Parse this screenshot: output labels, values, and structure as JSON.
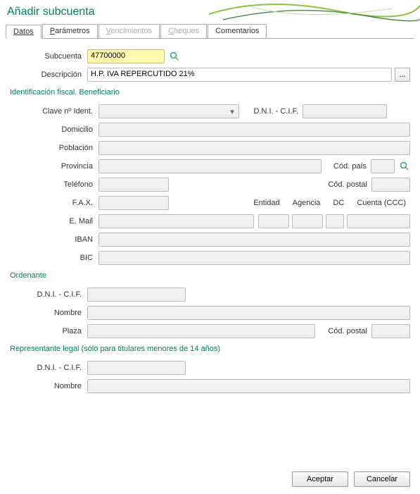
{
  "header": {
    "title": "Añadir subcuenta"
  },
  "tabs": {
    "datos": "Datos",
    "parametros_pre": "P",
    "parametros_rest": "arámetros",
    "vencimientos_pre": "V",
    "vencimientos_rest": "encimientos",
    "cheques_pre": "C",
    "cheques_rest": "heques",
    "comentarios": "Comentarios"
  },
  "form": {
    "subcuenta_label": "Subcuenta",
    "subcuenta_value": "47700000",
    "descripcion_label": "Descripción",
    "descripcion_value": "H.P. IVA REPERCUTIDO 21%",
    "ellipsis": "..."
  },
  "section1": {
    "title": "Identificación fiscal. Beneficiario",
    "clave_label": "Clave nº Ident.",
    "clave_value": "",
    "dni_label": "D.N.I. - C.I.F.",
    "dni_value": "",
    "domicilio_label": "Domicilio",
    "domicilio_value": "",
    "poblacion_label": "Población",
    "poblacion_value": "",
    "provincia_label": "Provincia",
    "provincia_value": "",
    "codpais_label": "Cód. país",
    "codpais_value": "",
    "telefono_label": "Teléfono",
    "telefono_value": "",
    "codpostal_label": "Cód. postal",
    "codpostal_value": "",
    "fax_label": "F.A.X.",
    "fax_value": "",
    "entidad_label": "Entidad",
    "entidad_value": "",
    "agencia_label": "Agencia",
    "agencia_value": "",
    "dc_label": "DC",
    "dc_value": "",
    "cuenta_label": "Cuenta (CCC)",
    "cuenta_value": "",
    "email_label": "E. Mail",
    "email_value": "",
    "iban_label": "IBAN",
    "iban_value": "",
    "bic_label": "BIC",
    "bic_value": ""
  },
  "section2": {
    "title": "Ordenante",
    "dni_label": "D.N.I. - C.I.F.",
    "dni_value": "",
    "nombre_label": "Nombre",
    "nombre_value": "",
    "plaza_label": "Plaza",
    "plaza_value": "",
    "codpostal_label": "Cód. postal",
    "codpostal_value": ""
  },
  "section3": {
    "title": "Representante legal (sólo para titulares menores de 14 años)",
    "dni_label": "D.N.I. - C.I.F.",
    "dni_value": "",
    "nombre_label": "Nombre",
    "nombre_value": ""
  },
  "buttons": {
    "accept": "Aceptar",
    "cancel": "Cancelar"
  }
}
